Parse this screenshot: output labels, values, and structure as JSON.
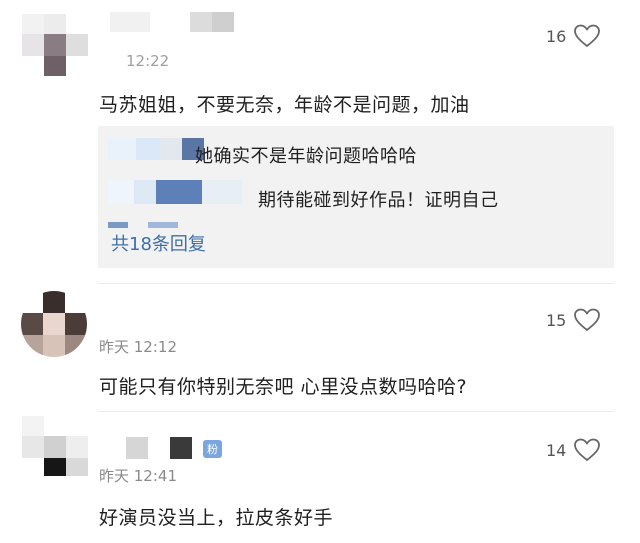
{
  "comments": [
    {
      "time": "12:22",
      "text": "马苏姐姐，不要无奈，年龄不是问题，加油",
      "likes": "16",
      "replies": [
        {
          "text": "她确实不是年龄问题哈哈哈"
        },
        {
          "text": "期待能碰到好作品！证明自己"
        }
      ],
      "reply_link": "共18条回复"
    },
    {
      "time": "昨天 12:12",
      "text": "可能只有你特别无奈吧 心里没点数吗哈哈?",
      "likes": "15"
    },
    {
      "time": "昨天 12:41",
      "text": "好演员没当上，拉皮条好手",
      "likes": "14",
      "badge": "粉"
    }
  ],
  "icons": {
    "like": "heart-outline-icon"
  },
  "colors": {
    "link": "#3d6fa8",
    "reply_bg": "#f2f2f2",
    "badge": "#7aa6dd"
  }
}
